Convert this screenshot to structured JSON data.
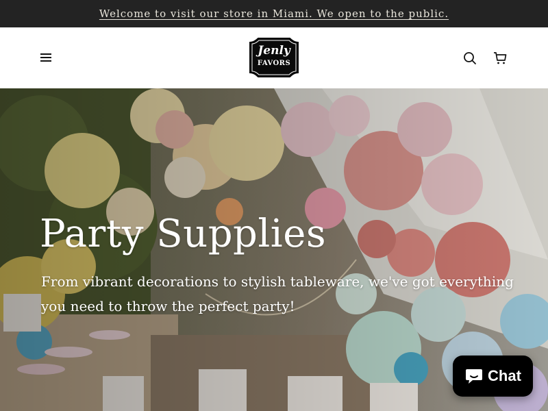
{
  "announcement": {
    "text": "Welcome to visit our store in Miami. We open to the public."
  },
  "header": {
    "logo": {
      "line1": "Jenly",
      "line2": "FAVORS"
    },
    "menu_icon": "hamburger-icon",
    "search_icon": "search-icon",
    "cart_icon": "cart-icon"
  },
  "hero": {
    "title": "Party Supplies",
    "subtitle": "From vibrant decorations to stylish tableware, we've got everything you need to throw the perfect party!"
  },
  "chat": {
    "label": "Chat",
    "icon": "chat-bubble-icon"
  },
  "colors": {
    "announcement_bg": "#232323",
    "announcement_text": "#e9e6dc",
    "chat_bg": "#000000"
  }
}
